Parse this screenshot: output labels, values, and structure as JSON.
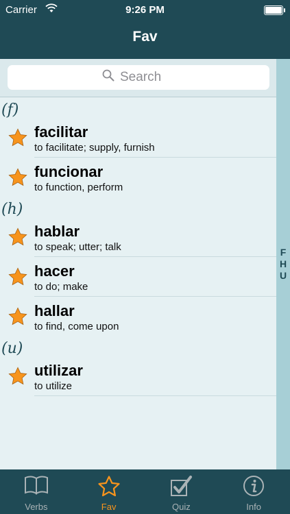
{
  "status": {
    "carrier": "Carrier",
    "time": "9:26 PM"
  },
  "nav": {
    "title": "Fav"
  },
  "search": {
    "placeholder": "Search"
  },
  "sections": [
    {
      "header": "(f)",
      "rows": [
        {
          "word": "facilitar",
          "def": "to facilitate; supply, furnish"
        },
        {
          "word": "funcionar",
          "def": "to function, perform"
        }
      ]
    },
    {
      "header": "(h)",
      "rows": [
        {
          "word": "hablar",
          "def": "to speak; utter; talk"
        },
        {
          "word": "hacer",
          "def": "to do; make"
        },
        {
          "word": "hallar",
          "def": "to find, come upon"
        }
      ]
    },
    {
      "header": "(u)",
      "rows": [
        {
          "word": "utilizar",
          "def": "to utilize"
        }
      ]
    }
  ],
  "index": [
    "F",
    "H",
    "U"
  ],
  "tabs": [
    {
      "label": "Verbs",
      "icon": "book-icon"
    },
    {
      "label": "Fav",
      "icon": "star-icon"
    },
    {
      "label": "Quiz",
      "icon": "checkbox-icon"
    },
    {
      "label": "Info",
      "icon": "info-icon"
    }
  ],
  "colors": {
    "nav": "#1f4a55",
    "accent": "#f7941d",
    "background": "#e6f1f3",
    "index_bar": "#a7cfd6"
  }
}
